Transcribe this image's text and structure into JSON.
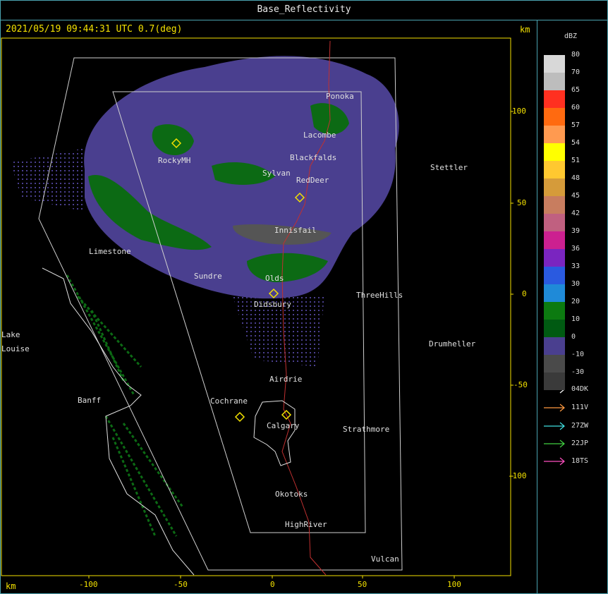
{
  "header": {
    "title": "Base_Reflectivity"
  },
  "scan": {
    "timestamp": "2021/05/19 09:44:31 UTC 0.7(deg)"
  },
  "axes": {
    "units_top": "km",
    "units_bottom": "km",
    "x_ticks": [
      "-100",
      "-50",
      "0",
      "50",
      "100"
    ],
    "y_ticks": [
      "100",
      "50",
      "0",
      "-50",
      "-100"
    ]
  },
  "legend": {
    "unit": "dBZ",
    "levels": [
      {
        "label": "80",
        "color": "#d8d8d8"
      },
      {
        "label": "70",
        "color": "#bdbdbd"
      },
      {
        "label": "65",
        "color": "#ff3020"
      },
      {
        "label": "60",
        "color": "#ff6a10"
      },
      {
        "label": "57",
        "color": "#ff9a50"
      },
      {
        "label": "54",
        "color": "#ffff00"
      },
      {
        "label": "51",
        "color": "#ffc830"
      },
      {
        "label": "48",
        "color": "#d59b3a"
      },
      {
        "label": "45",
        "color": "#c87d5f"
      },
      {
        "label": "42",
        "color": "#c06080"
      },
      {
        "label": "39",
        "color": "#cc2090"
      },
      {
        "label": "36",
        "color": "#7a25c0"
      },
      {
        "label": "33",
        "color": "#2a5ae0"
      },
      {
        "label": "30",
        "color": "#1f8ad8"
      },
      {
        "label": "20",
        "color": "#0c7a10"
      },
      {
        "label": "10",
        "color": "#005a12"
      },
      {
        "label": "0",
        "color": "#4a3f8f"
      },
      {
        "label": "-10",
        "color": "#4a4a4a"
      },
      {
        "label": "-30",
        "color": "#3a3a3a"
      }
    ],
    "tracks": [
      {
        "label": "04DK",
        "color": "#ffffff"
      },
      {
        "label": "111V",
        "color": "#ff9a40"
      },
      {
        "label": "27ZW",
        "color": "#40e0e0"
      },
      {
        "label": "22JP",
        "color": "#40d040"
      },
      {
        "label": "18TS",
        "color": "#ff50c0"
      }
    ]
  },
  "places": [
    {
      "name": "Ponoka"
    },
    {
      "name": "Lacombe"
    },
    {
      "name": "Blackfalds"
    },
    {
      "name": "RockyMH"
    },
    {
      "name": "Sylvan"
    },
    {
      "name": "RedDeer"
    },
    {
      "name": "Stettler"
    },
    {
      "name": "Innisfail"
    },
    {
      "name": "Limestone"
    },
    {
      "name": "Sundre"
    },
    {
      "name": "Olds"
    },
    {
      "name": "ThreeHills"
    },
    {
      "name": "Didsbury"
    },
    {
      "name": "Lake"
    },
    {
      "name": "Louise"
    },
    {
      "name": "Drumheller"
    },
    {
      "name": "Airdrie"
    },
    {
      "name": "Banff"
    },
    {
      "name": "Cochrane"
    },
    {
      "name": "Calgary"
    },
    {
      "name": "Strathmore"
    },
    {
      "name": "Okotoks"
    },
    {
      "name": "HighRiver"
    },
    {
      "name": "Vulcan"
    }
  ]
}
